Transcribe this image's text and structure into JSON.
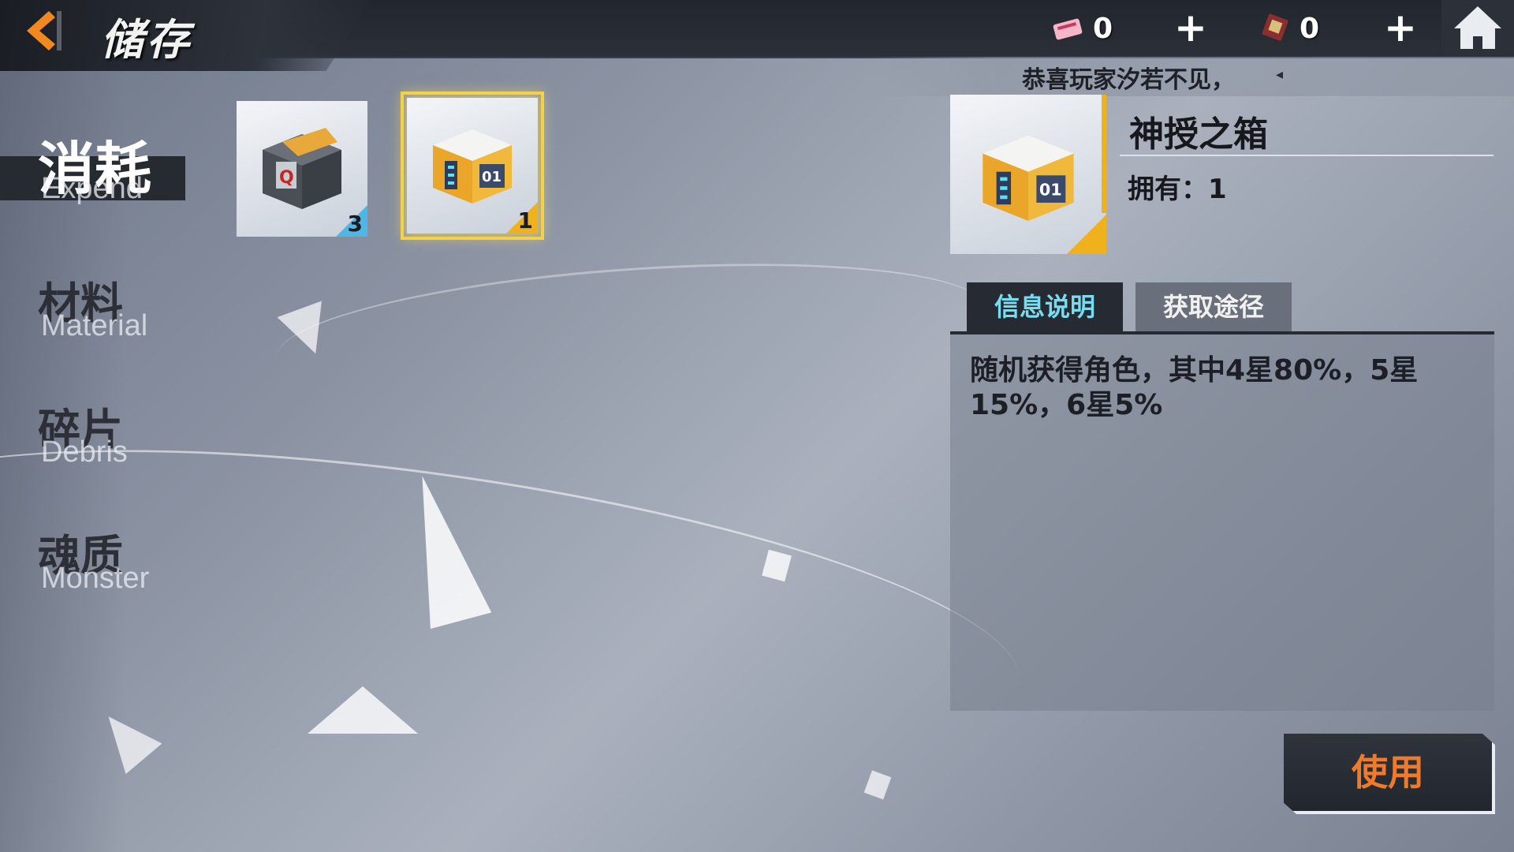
{
  "header": {
    "title": "储存",
    "resources": [
      {
        "name": "ticket-icon",
        "value": "0"
      },
      {
        "name": "chip-icon",
        "value": "0"
      }
    ]
  },
  "broadcast": {
    "text": "恭喜玩家汐若不见，",
    "mark": "◂"
  },
  "tabs": [
    {
      "cn": "消耗",
      "en": "Expend",
      "active": true
    },
    {
      "cn": "材料",
      "en": "Material",
      "active": false
    },
    {
      "cn": "碎片",
      "en": "Debris",
      "active": false
    },
    {
      "cn": "魂质",
      "en": "Monster",
      "active": false
    }
  ],
  "items": [
    {
      "name": "dark-crate",
      "count": "3",
      "rarity_color": "#4fb7e6"
    },
    {
      "name": "divine-box",
      "count": "1",
      "rarity_color": "#f0b21c"
    }
  ],
  "detail": {
    "name": "神授之箱",
    "owned": "拥有：1",
    "tab_info": "信息说明",
    "tab_source": "获取途径",
    "description": "随机获得角色，其中4星80%，5星15%，6星5%",
    "use_button": "使用"
  },
  "colors": {
    "accent_cyan": "#78dcf0",
    "use_orange": "#f07a2c",
    "back_orange": "#f08a1e",
    "selected_gold": "#f3d24a"
  }
}
